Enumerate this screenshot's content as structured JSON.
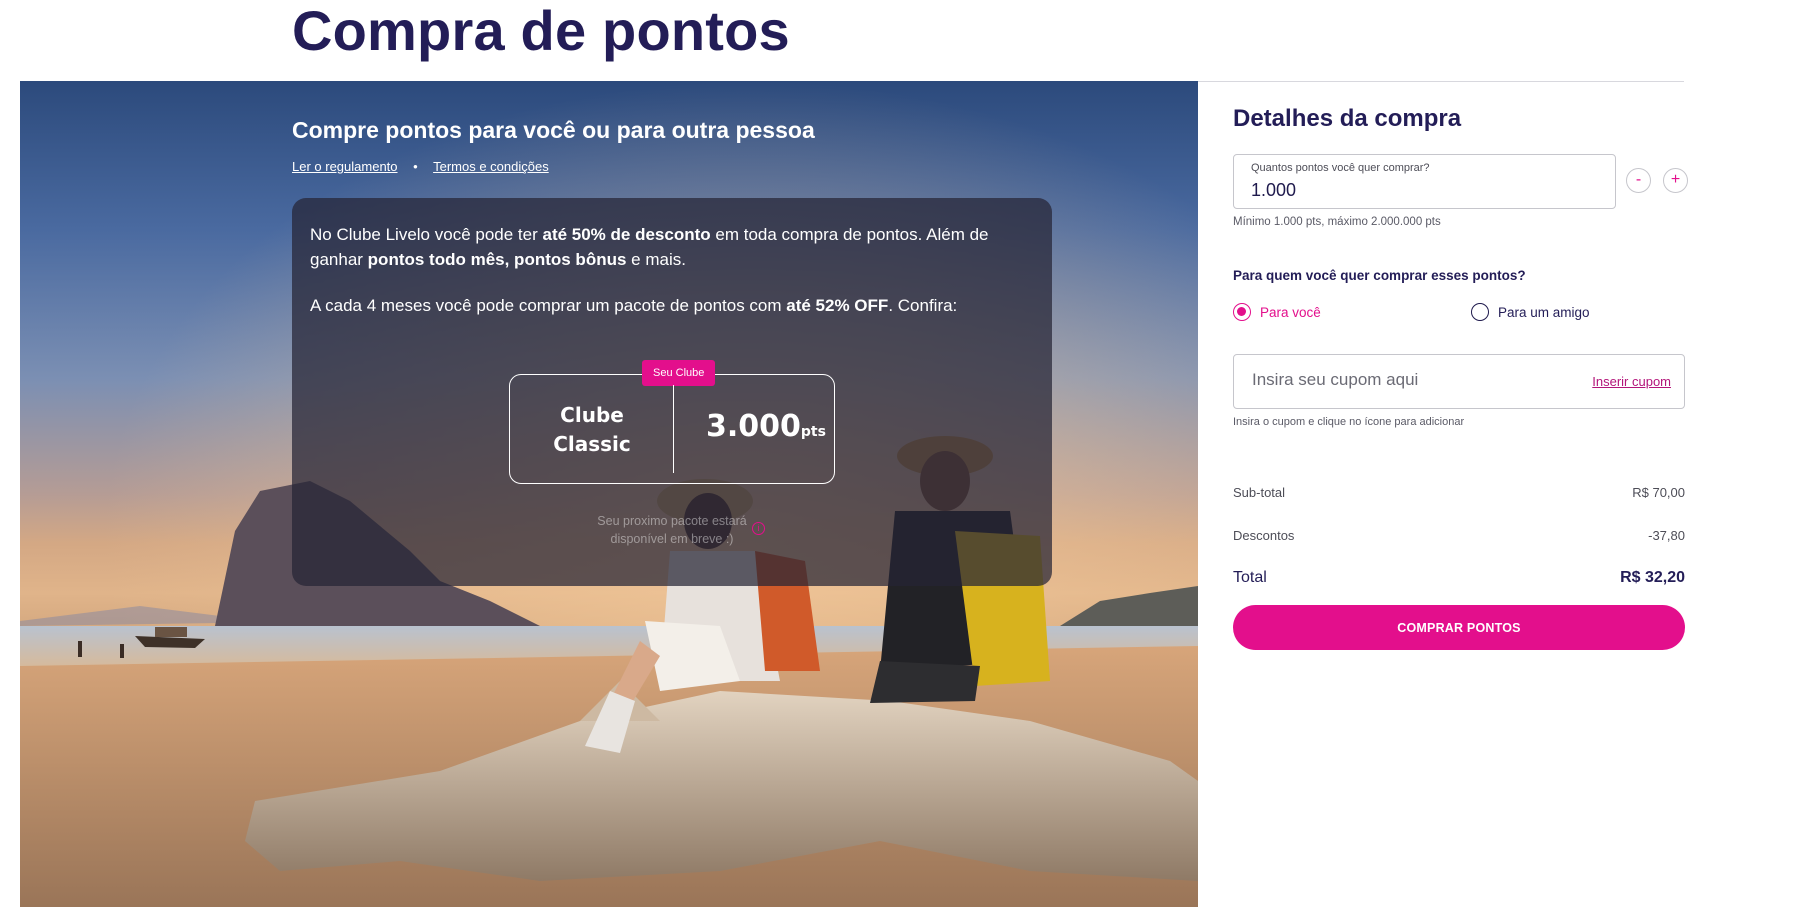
{
  "page": {
    "title": "Compra de pontos"
  },
  "hero": {
    "heading": "Compre pontos para você ou para outra pessoa",
    "links": [
      "Ler o regulamento",
      "Termos e condições"
    ],
    "separator": "•",
    "card": {
      "p1_a": "No Clube Livelo você pode ter ",
      "p1_b": "até 50% de desconto",
      "p1_c": " em toda compra de pontos. Além de ganhar ",
      "p1_d": "pontos todo mês, pontos bônus",
      "p1_e": " e mais.",
      "p2_a": "A cada 4 meses você pode comprar um pacote de pontos com ",
      "p2_b": "até 52% OFF",
      "p2_c": ". Confira:",
      "package": {
        "badge": "Seu Clube",
        "name_line1": "Clube",
        "name_line2": "Classic",
        "points": "3.000",
        "unit": "pts"
      },
      "next_line1": "Seu proximo pacote estará",
      "next_line2": "disponível em breve :)",
      "info_icon": "info-icon"
    }
  },
  "purchase": {
    "heading": "Detalhes da compra",
    "qty_label": "Quantos pontos você quer comprar?",
    "qty_value": "1.000",
    "minus": "-",
    "plus": "+",
    "qty_hint": "Mínimo 1.000 pts, máximo 2.000.000 pts",
    "who_question": "Para quem você quer comprar esses pontos?",
    "options": [
      {
        "label": "Para você",
        "selected": true
      },
      {
        "label": "Para um amigo",
        "selected": false
      }
    ],
    "coupon_placeholder": "Insira seu cupom aqui",
    "coupon_apply": "Inserir cupom",
    "coupon_hint": "Insira o cupom e clique no ícone para adicionar",
    "subtotal_label": "Sub-total",
    "subtotal_value": "R$ 70,00",
    "discount_label": "Descontos",
    "discount_value": "-37,80",
    "total_label": "Total",
    "total_value": "R$ 32,20",
    "buy_button": "COMPRAR PONTOS"
  },
  "colors": {
    "brand_pink": "#e30f8c",
    "title_navy": "#231d57"
  }
}
